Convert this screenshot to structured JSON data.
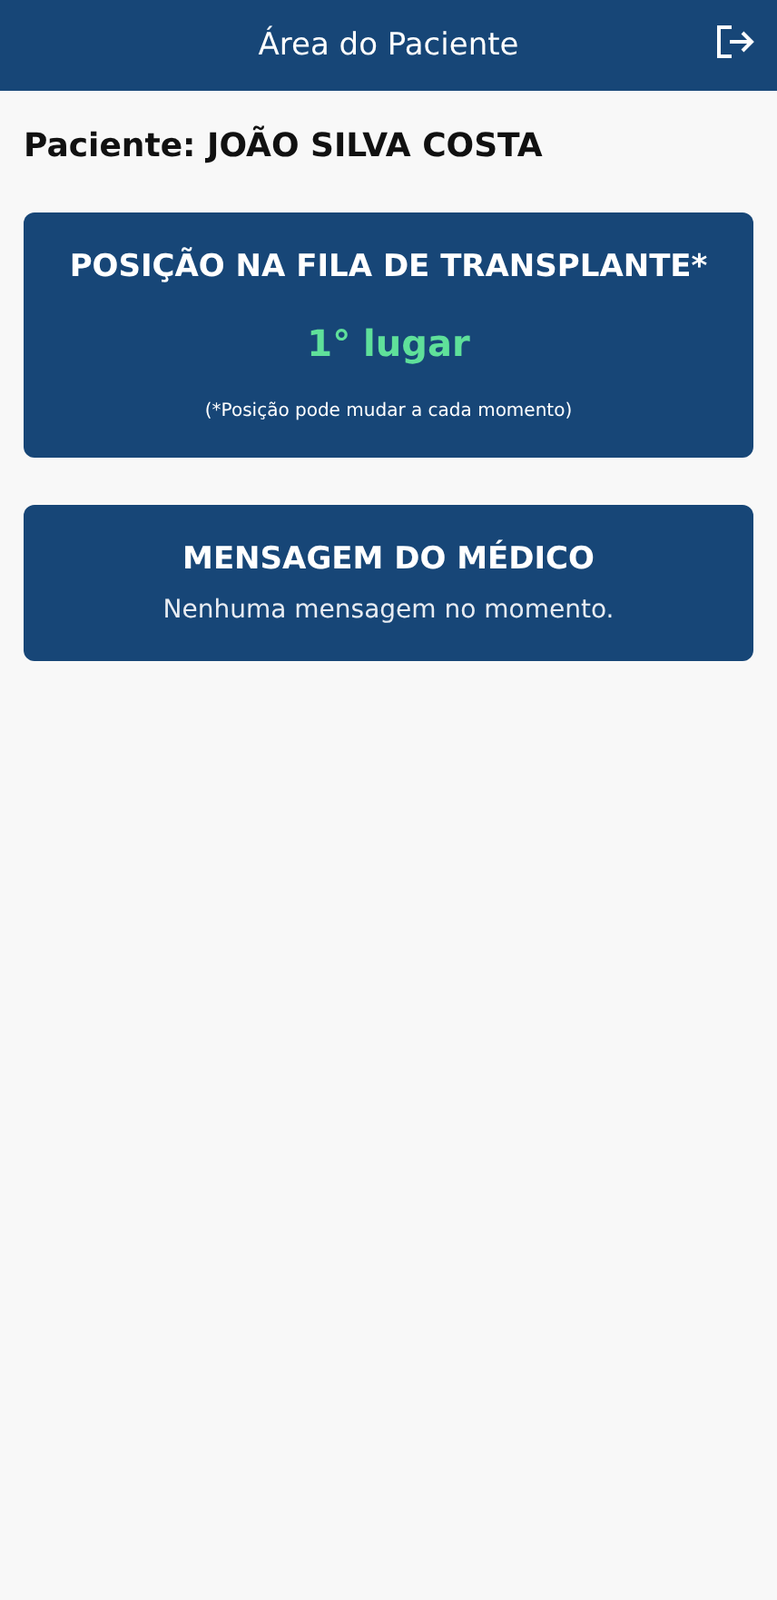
{
  "header": {
    "title": "Área do Paciente"
  },
  "patient": {
    "label": "Paciente: JOÃO SILVA COSTA"
  },
  "queue_card": {
    "title": "POSIÇÃO NA FILA DE TRANSPLANTE*",
    "position": "1° lugar",
    "note": "(*Posição pode mudar a cada momento)"
  },
  "message_card": {
    "title": "MENSAGEM DO MÉDICO",
    "message": "Nenhuma mensagem no momento."
  }
}
